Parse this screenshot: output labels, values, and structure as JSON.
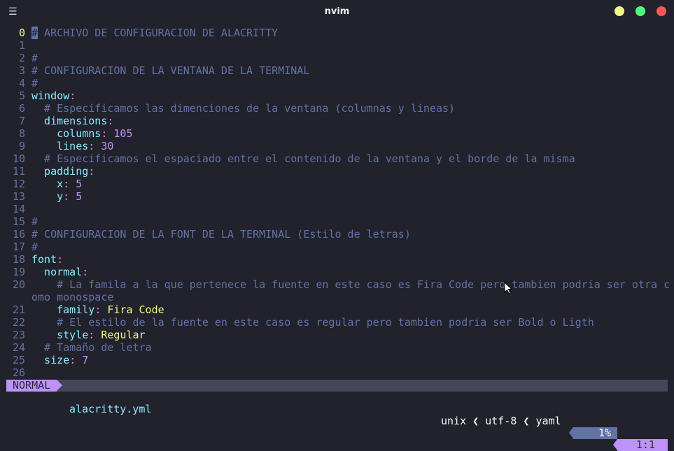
{
  "window": {
    "title": "nvim",
    "menu_icon": "hamburger-icon",
    "buttons": {
      "minimize": "#f1fa8c",
      "maximize": "#50fa7b",
      "close": "#ff5555"
    }
  },
  "lines": [
    {
      "num": "0",
      "parts": [
        [
          "cursor",
          "#"
        ],
        [
          "c",
          " ARCHIVO DE CONFIGURACION DE ALACRITTY"
        ]
      ]
    },
    {
      "num": "1",
      "parts": []
    },
    {
      "num": "2",
      "parts": [
        [
          "c",
          "#"
        ]
      ]
    },
    {
      "num": "3",
      "parts": [
        [
          "c",
          "# CONFIGURACION DE LA VENTANA DE LA TERMINAL"
        ]
      ]
    },
    {
      "num": "4",
      "parts": [
        [
          "c",
          "#"
        ]
      ]
    },
    {
      "num": "5",
      "parts": [
        [
          "k",
          "window"
        ],
        [
          "p",
          ":"
        ]
      ]
    },
    {
      "num": "6",
      "parts": [
        [
          "c",
          "  # Especificamos las dimenciones de la ventana (columnas y lineas)"
        ]
      ]
    },
    {
      "num": "7",
      "parts": [
        [
          "k",
          "  dimensions"
        ],
        [
          "p",
          ":"
        ]
      ]
    },
    {
      "num": "8",
      "parts": [
        [
          "k",
          "    columns"
        ],
        [
          "p",
          ":"
        ],
        [
          "n",
          " 105"
        ]
      ]
    },
    {
      "num": "9",
      "parts": [
        [
          "k",
          "    lines"
        ],
        [
          "p",
          ":"
        ],
        [
          "n",
          " 30"
        ]
      ]
    },
    {
      "num": "10",
      "parts": [
        [
          "c",
          "  # Especificamos el espaciado entre el contenido de la ventana y el borde de la misma"
        ]
      ]
    },
    {
      "num": "11",
      "parts": [
        [
          "k",
          "  padding"
        ],
        [
          "p",
          ":"
        ]
      ]
    },
    {
      "num": "12",
      "parts": [
        [
          "k",
          "    x"
        ],
        [
          "p",
          ":"
        ],
        [
          "n",
          " 5"
        ]
      ]
    },
    {
      "num": "13",
      "parts": [
        [
          "k",
          "    y"
        ],
        [
          "p",
          ":"
        ],
        [
          "n",
          " 5"
        ]
      ]
    },
    {
      "num": "14",
      "parts": []
    },
    {
      "num": "15",
      "parts": [
        [
          "c",
          "#"
        ]
      ]
    },
    {
      "num": "16",
      "parts": [
        [
          "c",
          "# CONFIGURACION DE LA FONT DE LA TERMINAL (Estilo de letras)"
        ]
      ]
    },
    {
      "num": "17",
      "parts": [
        [
          "c",
          "#"
        ]
      ]
    },
    {
      "num": "18",
      "parts": [
        [
          "k",
          "font"
        ],
        [
          "p",
          ":"
        ]
      ]
    },
    {
      "num": "19",
      "parts": [
        [
          "k",
          "  normal"
        ],
        [
          "p",
          ":"
        ]
      ]
    },
    {
      "num": "20",
      "parts": [
        [
          "c",
          "    # La famila a la que pertenece la fuente en este caso es Fira Code pero tambien podria ser otra c"
        ]
      ]
    },
    {
      "num": "",
      "parts": [
        [
          "c",
          "omo monospace"
        ]
      ]
    },
    {
      "num": "21",
      "parts": [
        [
          "k",
          "    family"
        ],
        [
          "p",
          ":"
        ],
        [
          "s",
          " Fira Code"
        ]
      ]
    },
    {
      "num": "22",
      "parts": [
        [
          "c",
          "    # El estilo de la fuente en este caso es regular pero tambien podria ser Bold o Ligth"
        ]
      ]
    },
    {
      "num": "23",
      "parts": [
        [
          "k",
          "    style"
        ],
        [
          "p",
          ":"
        ],
        [
          "s",
          " Regular"
        ]
      ]
    },
    {
      "num": "24",
      "parts": [
        [
          "c",
          "  # Tamaño de letra"
        ]
      ]
    },
    {
      "num": "25",
      "parts": [
        [
          "k",
          "  size"
        ],
        [
          "p",
          ":"
        ],
        [
          "n",
          " 7"
        ]
      ]
    },
    {
      "num": "26",
      "parts": []
    }
  ],
  "statusline": {
    "mode": "NORMAL",
    "filename": "alacritty.yml",
    "fileformat": "unix",
    "encoding": "utf-8",
    "filetype": "yaml",
    "separator": "❮",
    "percent": "1%",
    "position": "1:1"
  }
}
